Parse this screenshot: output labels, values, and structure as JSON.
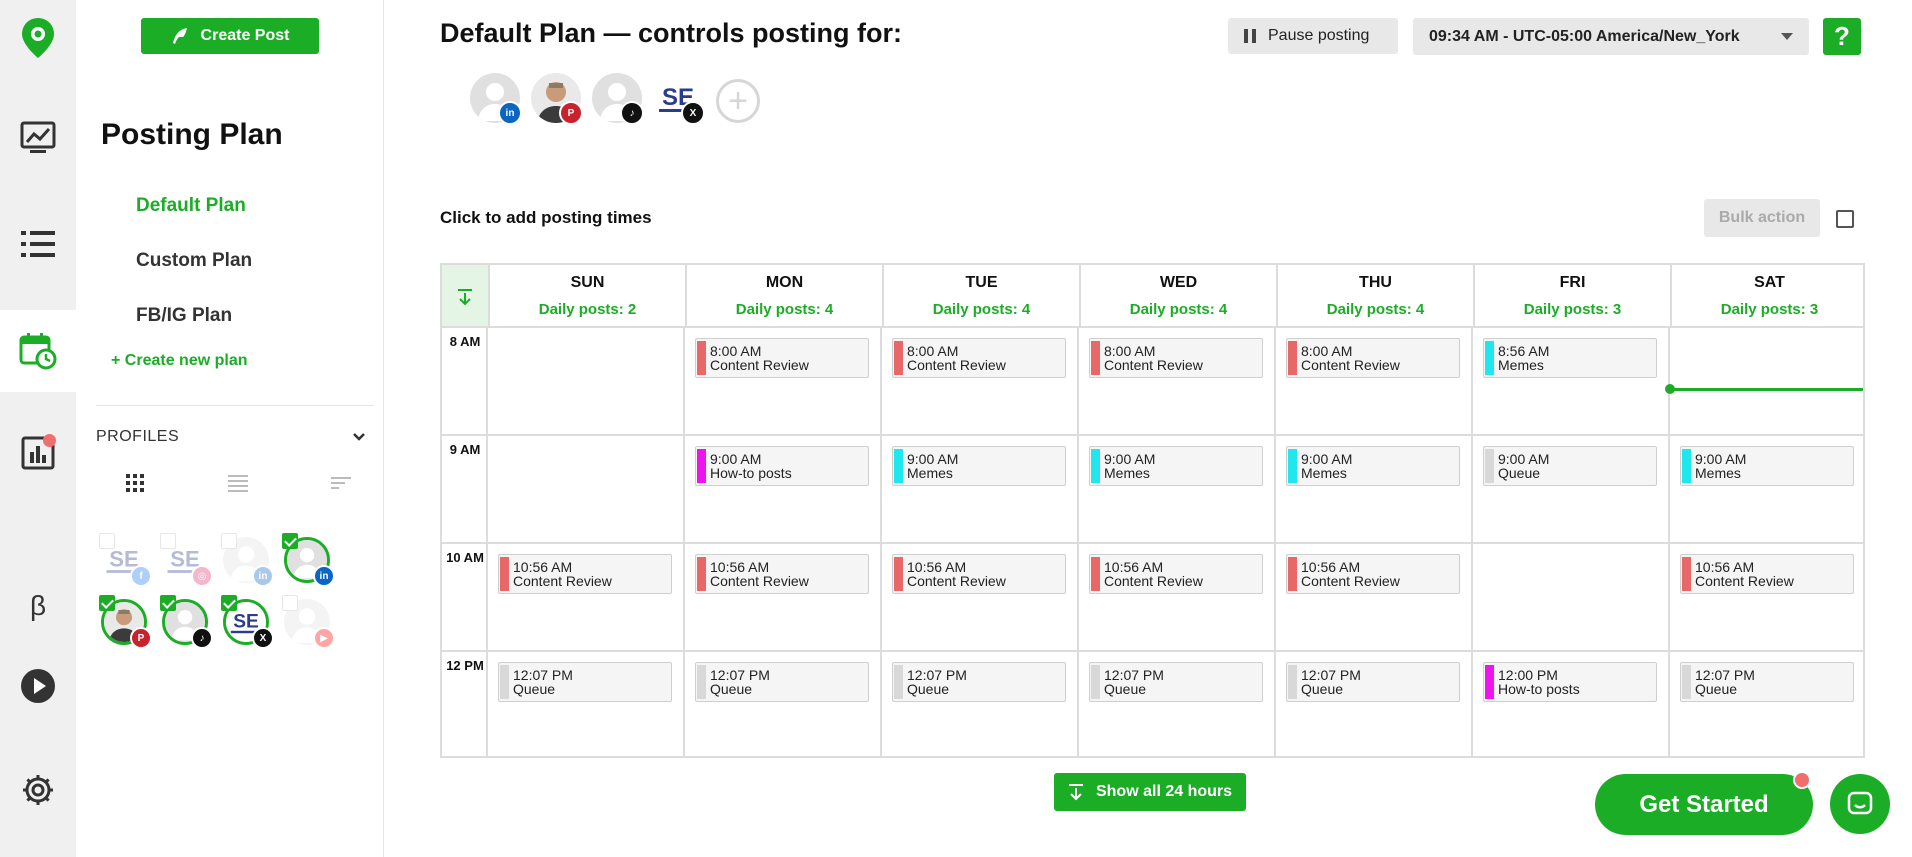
{
  "rail": {
    "items": [
      {
        "icon": "logo-pin-icon"
      },
      {
        "icon": "analytics-image-icon"
      },
      {
        "icon": "list-icon"
      },
      {
        "icon": "calendar-clock-icon",
        "active": true
      },
      {
        "icon": "bar-chart-icon",
        "badge": true
      },
      {
        "icon": "beta-icon",
        "glyph": "β"
      },
      {
        "icon": "play-icon"
      },
      {
        "icon": "gear-icon"
      }
    ]
  },
  "sidebar": {
    "create_post_label": "Create Post",
    "title": "Posting Plan",
    "plans": [
      {
        "label": "Default Plan",
        "active": true
      },
      {
        "label": "Custom Plan",
        "active": false
      },
      {
        "label": "FB/IG Plan",
        "active": false
      }
    ],
    "create_plan_label": "+ Create new plan",
    "profiles_label": "PROFILES",
    "profiles": [
      {
        "kind": "logo",
        "network": "facebook",
        "selected": false
      },
      {
        "kind": "logo",
        "network": "instagram",
        "selected": false
      },
      {
        "kind": "person",
        "network": "linkedin",
        "selected": false
      },
      {
        "kind": "person",
        "network": "linkedin",
        "selected": true
      },
      {
        "kind": "photo",
        "network": "pinterest",
        "selected": true
      },
      {
        "kind": "person",
        "network": "tiktok",
        "selected": true
      },
      {
        "kind": "logo",
        "network": "x",
        "selected": true
      },
      {
        "kind": "person",
        "network": "youtube",
        "selected": false
      }
    ]
  },
  "header": {
    "title": "Default Plan — controls posting for:",
    "pause_label": "Pause posting",
    "timezone": "09:34 AM - UTC-05:00 America/New_York",
    "help_label": "?",
    "add_times_label": "Click to add posting times",
    "bulk_label": "Bulk action",
    "avatars": [
      {
        "kind": "person",
        "network": "linkedin"
      },
      {
        "kind": "photo",
        "network": "pinterest"
      },
      {
        "kind": "person",
        "network": "tiktok"
      },
      {
        "kind": "logo",
        "network": "x"
      }
    ]
  },
  "calendar": {
    "days": [
      {
        "name": "SUN",
        "posts": "Daily posts: 2"
      },
      {
        "name": "MON",
        "posts": "Daily posts: 4"
      },
      {
        "name": "TUE",
        "posts": "Daily posts: 4"
      },
      {
        "name": "WED",
        "posts": "Daily posts: 4"
      },
      {
        "name": "THU",
        "posts": "Daily posts: 4"
      },
      {
        "name": "FRI",
        "posts": "Daily posts: 3"
      },
      {
        "name": "SAT",
        "posts": "Daily posts: 3"
      }
    ],
    "hours": [
      "8 AM",
      "9 AM",
      "10 AM",
      "12 PM"
    ],
    "slots": [
      {
        "day": 1,
        "hour": 0,
        "time": "8:00 AM",
        "label": "Content Review",
        "color": "#e8686a"
      },
      {
        "day": 2,
        "hour": 0,
        "time": "8:00 AM",
        "label": "Content Review",
        "color": "#e8686a"
      },
      {
        "day": 3,
        "hour": 0,
        "time": "8:00 AM",
        "label": "Content Review",
        "color": "#e8686a"
      },
      {
        "day": 4,
        "hour": 0,
        "time": "8:00 AM",
        "label": "Content Review",
        "color": "#e8686a"
      },
      {
        "day": 5,
        "hour": 0,
        "time": "8:56 AM",
        "label": "Memes",
        "color": "#20e6ee"
      },
      {
        "day": 1,
        "hour": 1,
        "time": "9:00 AM",
        "label": "How-to posts",
        "color": "#ee14ee"
      },
      {
        "day": 2,
        "hour": 1,
        "time": "9:00 AM",
        "label": "Memes",
        "color": "#20e6ee"
      },
      {
        "day": 3,
        "hour": 1,
        "time": "9:00 AM",
        "label": "Memes",
        "color": "#20e6ee"
      },
      {
        "day": 4,
        "hour": 1,
        "time": "9:00 AM",
        "label": "Memes",
        "color": "#20e6ee"
      },
      {
        "day": 5,
        "hour": 1,
        "time": "9:00 AM",
        "label": "Queue",
        "color": "#d8d8d8"
      },
      {
        "day": 6,
        "hour": 1,
        "time": "9:00 AM",
        "label": "Memes",
        "color": "#20e6ee"
      },
      {
        "day": 0,
        "hour": 2,
        "time": "10:56 AM",
        "label": "Content Review",
        "color": "#e8686a"
      },
      {
        "day": 1,
        "hour": 2,
        "time": "10:56 AM",
        "label": "Content Review",
        "color": "#e8686a"
      },
      {
        "day": 2,
        "hour": 2,
        "time": "10:56 AM",
        "label": "Content Review",
        "color": "#e8686a"
      },
      {
        "day": 3,
        "hour": 2,
        "time": "10:56 AM",
        "label": "Content Review",
        "color": "#e8686a"
      },
      {
        "day": 4,
        "hour": 2,
        "time": "10:56 AM",
        "label": "Content Review",
        "color": "#e8686a"
      },
      {
        "day": 6,
        "hour": 2,
        "time": "10:56 AM",
        "label": "Content Review",
        "color": "#e8686a"
      },
      {
        "day": 0,
        "hour": 3,
        "time": "12:07 PM",
        "label": "Queue",
        "color": "#d8d8d8"
      },
      {
        "day": 1,
        "hour": 3,
        "time": "12:07 PM",
        "label": "Queue",
        "color": "#d8d8d8"
      },
      {
        "day": 2,
        "hour": 3,
        "time": "12:07 PM",
        "label": "Queue",
        "color": "#d8d8d8"
      },
      {
        "day": 3,
        "hour": 3,
        "time": "12:07 PM",
        "label": "Queue",
        "color": "#d8d8d8"
      },
      {
        "day": 4,
        "hour": 3,
        "time": "12:07 PM",
        "label": "Queue",
        "color": "#d8d8d8"
      },
      {
        "day": 5,
        "hour": 3,
        "time": "12:00 PM",
        "label": "How-to posts",
        "color": "#ee14ee"
      },
      {
        "day": 6,
        "hour": 3,
        "time": "12:07 PM",
        "label": "Queue",
        "color": "#d8d8d8"
      }
    ],
    "now_marker": {
      "day": 6,
      "hour": 0
    }
  },
  "footer": {
    "show_all_label": "Show all 24 hours",
    "get_started_label": "Get Started"
  },
  "colors": {
    "accent": "#1cad27",
    "linkedin": "#0a66c2",
    "pinterest": "#c8232c",
    "tiktok": "#111111",
    "x": "#111111",
    "facebook": "#1877f2",
    "instagram": "#e1306c",
    "youtube": "#ff0000"
  }
}
